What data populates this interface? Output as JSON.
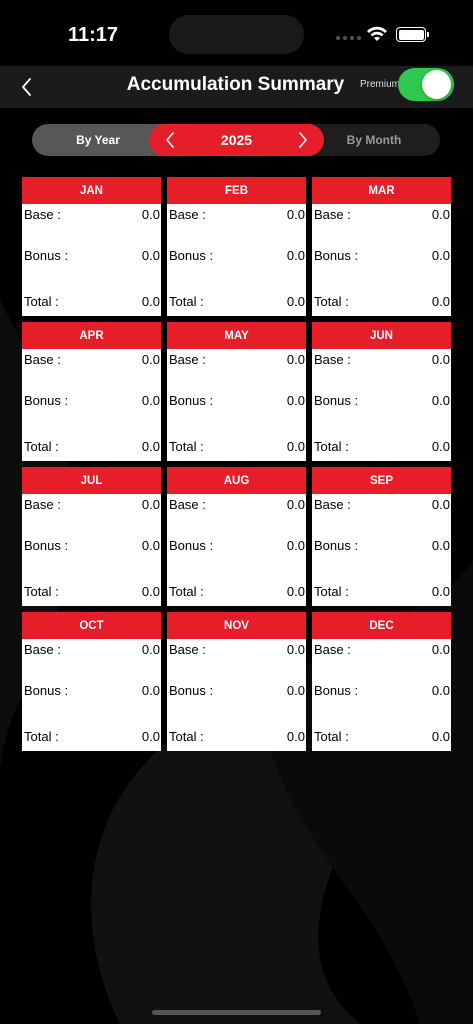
{
  "status_bar": {
    "time": "11:17"
  },
  "nav": {
    "title": "Accumulation Summary",
    "premium_label": "Premium",
    "premium_enabled": true
  },
  "segment": {
    "by_year": "By Year",
    "year": "2025",
    "by_month": "By Month"
  },
  "labels": {
    "base": "Base :",
    "bonus": "Bonus :",
    "total": "Total :"
  },
  "months": [
    {
      "name": "JAN",
      "base": "0.0",
      "bonus": "0.0",
      "total": "0.0"
    },
    {
      "name": "FEB",
      "base": "0.0",
      "bonus": "0.0",
      "total": "0.0"
    },
    {
      "name": "MAR",
      "base": "0.0",
      "bonus": "0.0",
      "total": "0.0"
    },
    {
      "name": "APR",
      "base": "0.0",
      "bonus": "0.0",
      "total": "0.0"
    },
    {
      "name": "MAY",
      "base": "0.0",
      "bonus": "0.0",
      "total": "0.0"
    },
    {
      "name": "JUN",
      "base": "0.0",
      "bonus": "0.0",
      "total": "0.0"
    },
    {
      "name": "JUL",
      "base": "0.0",
      "bonus": "0.0",
      "total": "0.0"
    },
    {
      "name": "AUG",
      "base": "0.0",
      "bonus": "0.0",
      "total": "0.0"
    },
    {
      "name": "SEP",
      "base": "0.0",
      "bonus": "0.0",
      "total": "0.0"
    },
    {
      "name": "OCT",
      "base": "0.0",
      "bonus": "0.0",
      "total": "0.0"
    },
    {
      "name": "NOV",
      "base": "0.0",
      "bonus": "0.0",
      "total": "0.0"
    },
    {
      "name": "DEC",
      "base": "0.0",
      "bonus": "0.0",
      "total": "0.0"
    }
  ],
  "colors": {
    "accent": "#e51e2a",
    "toggle_on": "#2fc94f",
    "background": "#000000",
    "nav_bg": "#1b1b1b"
  }
}
